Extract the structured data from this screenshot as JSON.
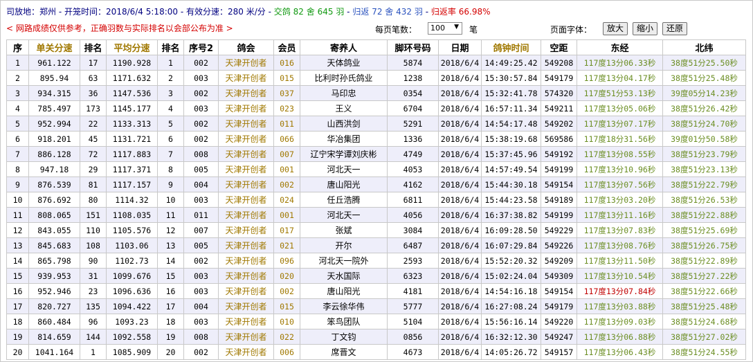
{
  "header": {
    "release_place_label": "司放地：",
    "release_place": "郑州",
    "release_time_label": "开笼时间：",
    "release_time": "2018/6/4 5:18:00",
    "speed_label": "有效分速：",
    "speed_value": "280 米/分",
    "entries_label": "交鸽",
    "entries_lofts": "82",
    "she_label": "舍",
    "entries_birds": "645",
    "yu_label": "羽",
    "returns_label": "归返",
    "returns_lofts": "72",
    "returns_birds": "432",
    "return_rate_label": "归返率",
    "return_rate": "66.98%",
    "dash": "-"
  },
  "notice": "< 网路成绩仅供参考，正确羽数与实际排名以会部公布为准 >",
  "controls": {
    "per_page_label": "每页笔数：",
    "per_page_value": "100",
    "per_page_unit": "笔",
    "font_label": "页面字体：",
    "enlarge": "放大",
    "shrink": "缩小",
    "restore": "还原"
  },
  "table": {
    "columns": [
      "序",
      "单关分速",
      "排名",
      "平均分速",
      "排名",
      "序号2",
      "鸽会",
      "会员",
      "寄养人",
      "脚环号码",
      "日期",
      "鸽钟时间",
      "空距",
      "东经",
      "北纬"
    ],
    "rows": [
      [
        "1",
        "961.122",
        "17",
        "1190.928",
        "1",
        "002",
        "天津开创者",
        "016",
        "天体鸽业",
        "5874",
        "2018/6/4",
        "14:49:25.42",
        "549208",
        "117度13分06.33秒",
        "38度51分25.50秒"
      ],
      [
        "2",
        "895.94",
        "63",
        "1171.632",
        "2",
        "003",
        "天津开创者",
        "015",
        "比利时孙氏鸽业",
        "1238",
        "2018/6/4",
        "15:30:57.84",
        "549179",
        "117度13分04.17秒",
        "38度51分25.48秒"
      ],
      [
        "3",
        "934.315",
        "36",
        "1147.536",
        "3",
        "002",
        "天津开创者",
        "037",
        "马印忠",
        "0354",
        "2018/6/4",
        "15:32:41.78",
        "574320",
        "117度51分53.13秒",
        "39度05分14.23秒"
      ],
      [
        "4",
        "785.497",
        "173",
        "1145.177",
        "4",
        "003",
        "天津开创者",
        "023",
        "王义",
        "6704",
        "2018/6/4",
        "16:57:11.34",
        "549211",
        "117度13分05.06秒",
        "38度51分26.42秒"
      ],
      [
        "5",
        "952.994",
        "22",
        "1133.313",
        "5",
        "002",
        "天津开创者",
        "011",
        "山西洪剑",
        "5291",
        "2018/6/4",
        "14:54:17.48",
        "549202",
        "117度13分07.17秒",
        "38度51分24.70秒"
      ],
      [
        "6",
        "918.201",
        "45",
        "1131.721",
        "6",
        "002",
        "天津开创者",
        "066",
        "华冶集团",
        "1336",
        "2018/6/4",
        "15:38:19.68",
        "569586",
        "117度18分31.56秒",
        "39度01分50.58秒"
      ],
      [
        "7",
        "886.128",
        "72",
        "1117.883",
        "7",
        "008",
        "天津开创者",
        "007",
        "辽宁宋学谭刘庆彬",
        "4749",
        "2018/6/4",
        "15:37:45.96",
        "549192",
        "117度13分08.55秒",
        "38度51分23.79秒"
      ],
      [
        "8",
        "947.18",
        "29",
        "1117.371",
        "8",
        "005",
        "天津开创者",
        "001",
        "河北天一",
        "4053",
        "2018/6/4",
        "14:57:49.54",
        "549199",
        "117度13分10.96秒",
        "38度51分23.13秒"
      ],
      [
        "9",
        "876.539",
        "81",
        "1117.157",
        "9",
        "004",
        "天津开创者",
        "002",
        "唐山阳光",
        "4162",
        "2018/6/4",
        "15:44:30.18",
        "549154",
        "117度13分07.56秒",
        "38度51分22.79秒"
      ],
      [
        "10",
        "876.692",
        "80",
        "1114.32",
        "10",
        "003",
        "天津开创者",
        "024",
        "任丘浩腾",
        "6811",
        "2018/6/4",
        "15:44:23.58",
        "549189",
        "117度13分03.20秒",
        "38度51分26.53秒"
      ],
      [
        "11",
        "808.065",
        "151",
        "1108.035",
        "11",
        "011",
        "天津开创者",
        "001",
        "河北天一",
        "4056",
        "2018/6/4",
        "16:37:38.82",
        "549199",
        "117度13分11.16秒",
        "38度51分22.88秒"
      ],
      [
        "12",
        "843.055",
        "110",
        "1105.576",
        "12",
        "007",
        "天津开创者",
        "017",
        "张斌",
        "3084",
        "2018/6/4",
        "16:09:28.50",
        "549229",
        "117度13分07.83秒",
        "38度51分25.69秒"
      ],
      [
        "13",
        "845.683",
        "108",
        "1103.06",
        "13",
        "005",
        "天津开创者",
        "021",
        "开尔",
        "6487",
        "2018/6/4",
        "16:07:29.84",
        "549226",
        "117度13分08.76秒",
        "38度51分26.75秒"
      ],
      [
        "14",
        "865.798",
        "90",
        "1102.73",
        "14",
        "002",
        "天津开创者",
        "096",
        "河北天一院外",
        "2593",
        "2018/6/4",
        "15:52:20.32",
        "549209",
        "117度13分11.50秒",
        "38度51分22.89秒"
      ],
      [
        "15",
        "939.953",
        "31",
        "1099.676",
        "15",
        "003",
        "天津开创者",
        "020",
        "天水国际",
        "6323",
        "2018/6/4",
        "15:02:24.04",
        "549309",
        "117度13分10.54秒",
        "38度51分27.22秒"
      ],
      [
        "16",
        "952.946",
        "23",
        "1096.636",
        "16",
        "003",
        "天津开创者",
        "002",
        "唐山阳光",
        "4181",
        "2018/6/4",
        "14:54:16.18",
        "549154",
        "117度13分07.84秒",
        "38度51分22.66秒"
      ],
      [
        "17",
        "820.727",
        "135",
        "1094.422",
        "17",
        "004",
        "天津开创者",
        "015",
        "李云徐华伟",
        "5777",
        "2018/6/4",
        "16:27:08.24",
        "549179",
        "117度13分03.88秒",
        "38度51分25.48秒"
      ],
      [
        "18",
        "860.484",
        "96",
        "1093.23",
        "18",
        "003",
        "天津开创者",
        "010",
        "笨鸟团队",
        "5104",
        "2018/6/4",
        "15:56:16.14",
        "549220",
        "117度13分09.03秒",
        "38度51分24.68秒"
      ],
      [
        "19",
        "814.659",
        "144",
        "1092.558",
        "19",
        "008",
        "天津开创者",
        "022",
        "丁文钧",
        "0856",
        "2018/6/4",
        "16:32:12.30",
        "549247",
        "117度13分06.88秒",
        "38度51分27.02秒"
      ],
      [
        "20",
        "1041.164",
        "1",
        "1085.909",
        "20",
        "002",
        "天津开创者",
        "006",
        "席晋文",
        "4673",
        "2018/6/4",
        "14:05:26.72",
        "549157",
        "117度13分06.43秒",
        "38度51分24.55秒"
      ]
    ],
    "highlight_red_row_index": 15
  }
}
